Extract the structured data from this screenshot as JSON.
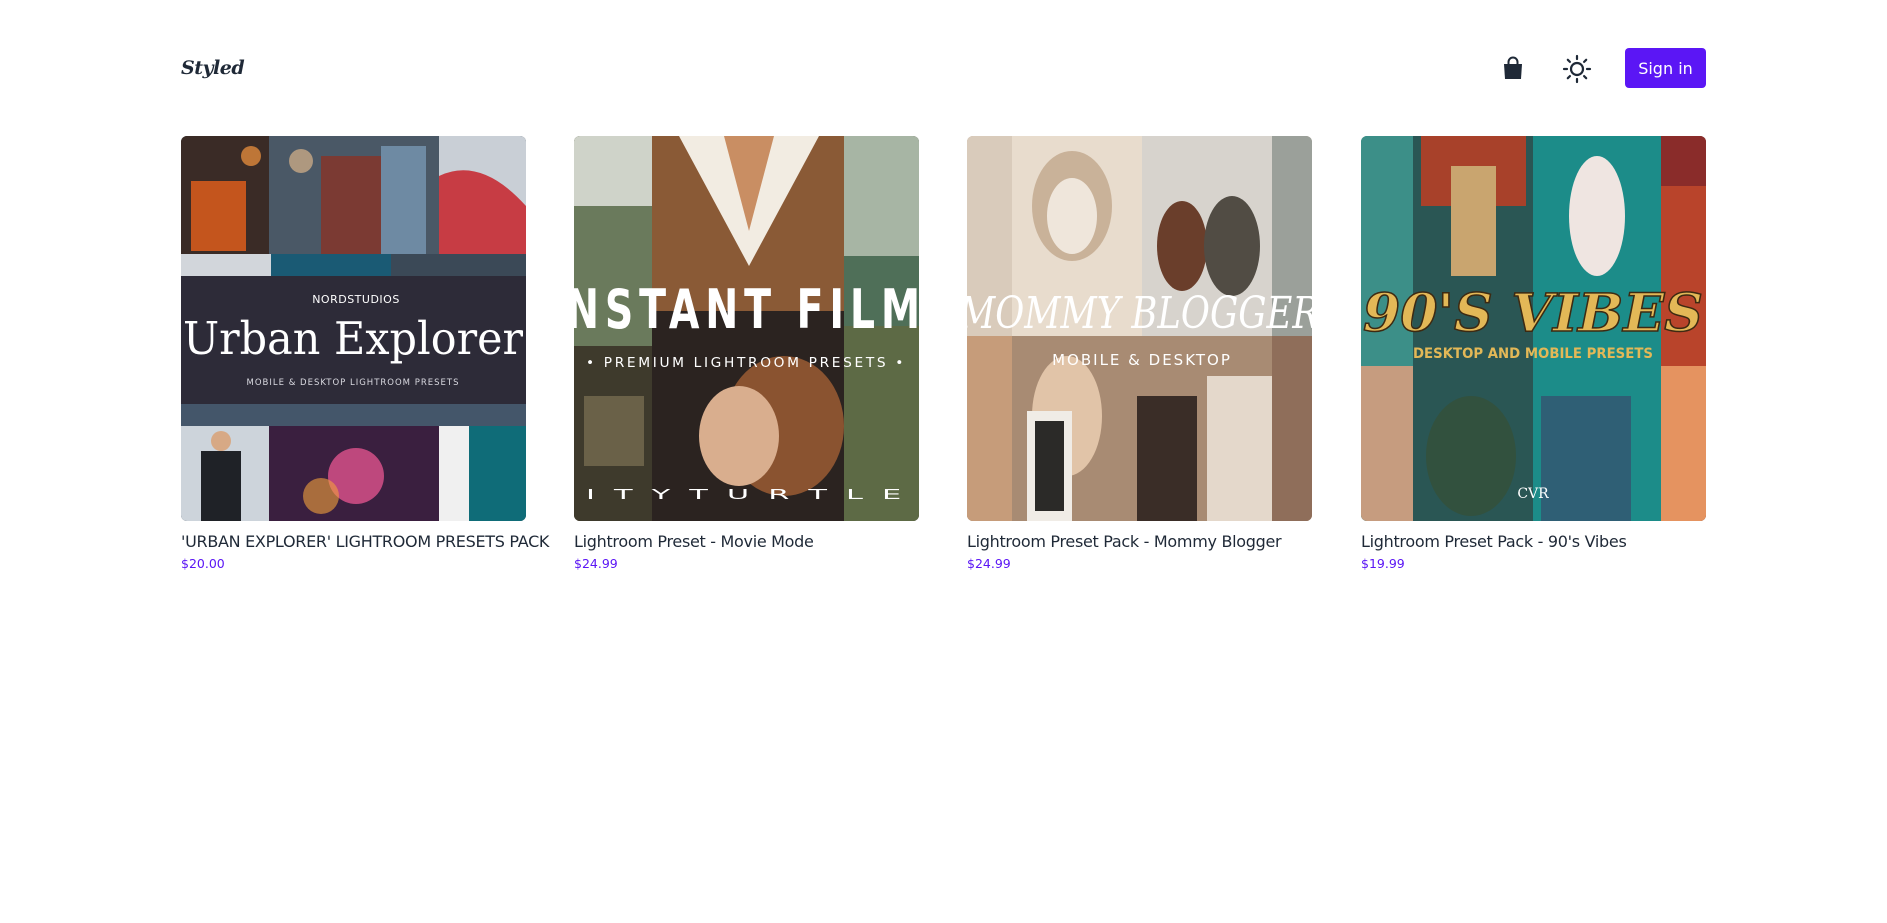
{
  "header": {
    "logo": "Styled",
    "cart_icon": "shopping-bag-icon",
    "theme_icon": "sun-icon",
    "signin_label": "Sign in"
  },
  "colors": {
    "accent": "#5b16f5",
    "text": "#1f2937",
    "background": "#ffffff"
  },
  "products": [
    {
      "title": "'URBAN EXPLORER' LIGHTROOM PRESETS PACK",
      "price": "$20.00",
      "image": {
        "brand": "NORDSTUDIOS",
        "headline": "Urban Explorer",
        "subtitle": "MOBILE & DESKTOP LIGHTROOM PRESETS"
      }
    },
    {
      "title": "Lightroom Preset - Movie Mode",
      "price": "$24.99",
      "image": {
        "headline": "NSTANT FILM",
        "subtitle": "• PREMIUM LIGHTROOM PRESETS •",
        "footer": "I T Y T U R T L E"
      }
    },
    {
      "title": "Lightroom Preset Pack - Mommy Blogger",
      "price": "$24.99",
      "image": {
        "headline": "MOMMY BLOGGER",
        "subtitle": "MOBILE & DESKTOP"
      }
    },
    {
      "title": "Lightroom Preset Pack - 90's Vibes",
      "price": "$19.99",
      "image": {
        "headline": "90'S VIBES",
        "subtitle": "DESKTOP AND MOBILE PRESETS",
        "mark": "CVR"
      }
    }
  ]
}
